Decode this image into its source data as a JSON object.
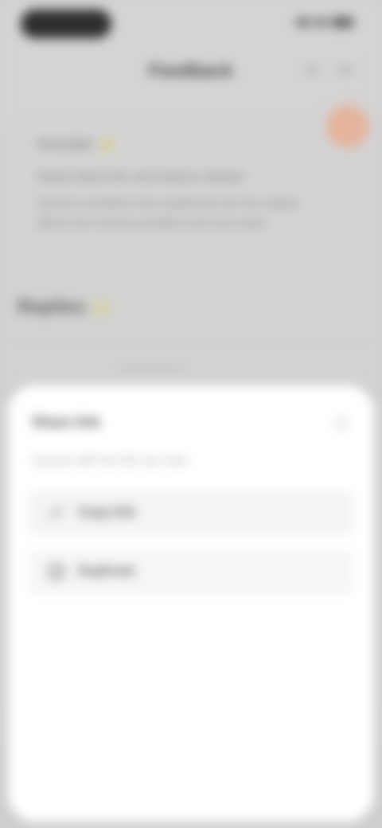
{
  "status_bar": {
    "icons": [
      "signal-icon",
      "wifi-icon",
      "battery-icon"
    ]
  },
  "header": {
    "title": "Feedback",
    "actions": [
      "more-icon",
      "minimize-icon"
    ]
  },
  "profile": {
    "name": "Sanaullah",
    "badge": "verified-badge-icon",
    "line": "Asked about the new feature release",
    "description": "Shared a detailed note explaining how the update affects the existing workflow and next steps"
  },
  "section": {
    "title": "Replies",
    "icon": "star-icon"
  },
  "sheet": {
    "title": "Share link",
    "subtitle": "Anyone with the link can view",
    "options": [
      {
        "label": "Copy link",
        "icon": "link-icon"
      },
      {
        "label": "Duplicate",
        "icon": "copy-icon"
      }
    ]
  },
  "colors": {
    "background": "#d2d2d2",
    "sheet": "#ffffff",
    "avatar": "#e4b49c",
    "badge": "#d8cd8c"
  }
}
